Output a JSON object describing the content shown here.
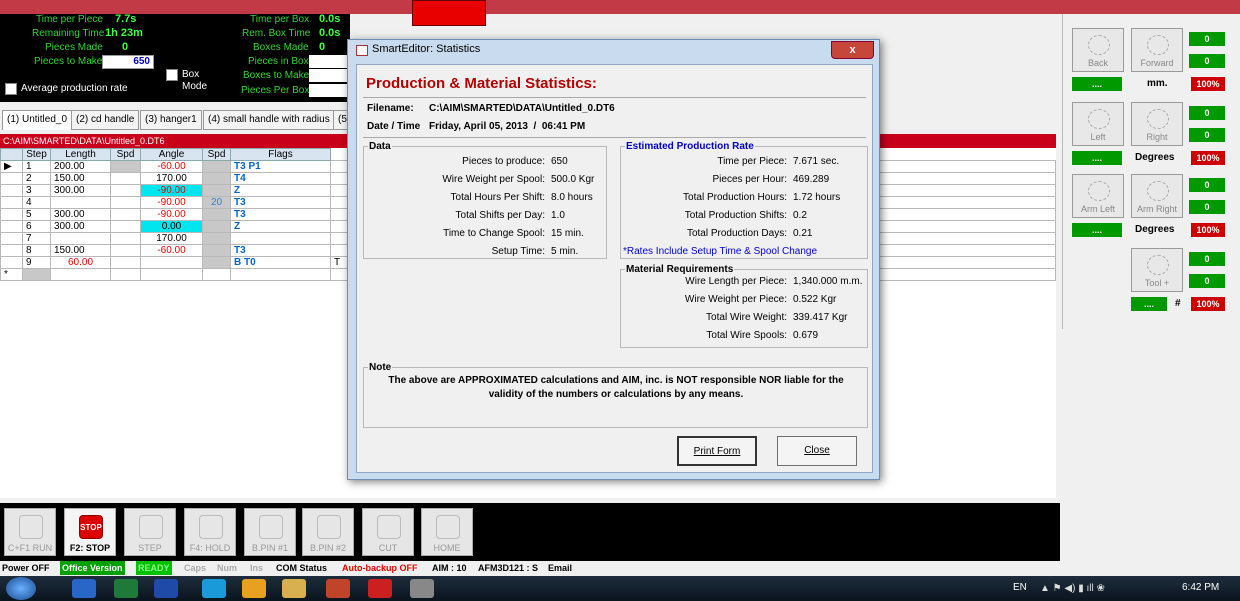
{
  "stats": {
    "time_per_piece_label": "Time per Piece",
    "time_per_piece": "7.7s",
    "remaining_time_label": "Remaining Time",
    "remaining_time": "1h 23m",
    "pieces_made_label": "Pieces Made",
    "pieces_made": "0",
    "pieces_to_make_label": "Pieces to Make",
    "pieces_to_make": "650",
    "time_per_box_label": "Time per Box",
    "time_per_box": "0.0s",
    "rem_box_time_label": "Rem. Box Time",
    "rem_box_time": "0.0s",
    "boxes_made_label": "Boxes Made",
    "boxes_made": "0",
    "pieces_in_box_label": "Pieces in Box",
    "boxes_to_make_label": "Boxes to Make",
    "pieces_per_box_label": "Pieces Per Box",
    "box_mode_label_1": "Box",
    "box_mode_label_2": "Mode",
    "avg_rate_label": "Average production rate"
  },
  "tabs": [
    "(1) Untitled_0",
    "(2) cd handle",
    "(3) hanger1",
    "(4) small handle with radius",
    "(5"
  ],
  "path": "C:\\AIM\\SMARTED\\DATA\\Untitled_0.DT6",
  "grid": {
    "headers": [
      "Step",
      "Length",
      "Spd",
      "Angle",
      "Spd",
      "Flags"
    ],
    "rows": [
      {
        "step": "1",
        "length": "200.00",
        "angle": "-60.00",
        "spd2": "",
        "flags": "T3 P1"
      },
      {
        "step": "2",
        "length": "150.00",
        "angle": "170.00",
        "spd2": "",
        "flags": "T4"
      },
      {
        "step": "3",
        "length": "300.00",
        "angle": "-90.00",
        "spd2": "",
        "flags": "Z"
      },
      {
        "step": "4",
        "length": "",
        "angle": "-90.00",
        "spd2": "20",
        "flags": "T3"
      },
      {
        "step": "5",
        "length": "300.00",
        "angle": "-90.00",
        "spd2": "",
        "flags": "T3"
      },
      {
        "step": "6",
        "length": "300.00",
        "angle": "0.00",
        "spd2": "",
        "flags": "Z"
      },
      {
        "step": "7",
        "length": "",
        "angle": "170.00",
        "spd2": "",
        "flags": ""
      },
      {
        "step": "8",
        "length": "150.00",
        "angle": "-60.00",
        "spd2": "",
        "flags": "T3"
      },
      {
        "step": "9",
        "length": "60.00",
        "angle": "",
        "spd2": "",
        "flags": "B T0"
      }
    ],
    "new_row_marker": "*",
    "row9_extra": "T"
  },
  "right_panel": {
    "back": "Back",
    "forward": "Forward",
    "mm": "mm.",
    "left": "Left",
    "right": "Right",
    "degrees1": "Degrees",
    "arm_left": "Arm Left",
    "arm_right": "Arm Right",
    "degrees2": "Degrees",
    "tool": "Tool +",
    "hash": "#",
    "zero": "0",
    "pct": "100%",
    "dots": "...."
  },
  "toolbar": [
    {
      "label": "C+F1 RUN"
    },
    {
      "label": "F2: STOP"
    },
    {
      "label": "STEP"
    },
    {
      "label": "F4: HOLD"
    },
    {
      "label": "B.PIN #1"
    },
    {
      "label": "B.PIN #2"
    },
    {
      "label": "CUT"
    },
    {
      "label": "HOME"
    }
  ],
  "stop_text": "STOP",
  "statusbar": {
    "power": "Power OFF",
    "office": "Office Version",
    "ready": "READY",
    "caps": "Caps",
    "num": "Num",
    "ins": "Ins",
    "com": "COM Status",
    "autobackup": "Auto-backup OFF",
    "aim": "AIM : 10",
    "afm": "AFM3D121 : S",
    "email": "Email"
  },
  "taskbar": {
    "lang": "EN",
    "time": "6:42 PM"
  },
  "dialog": {
    "title": "SmartEditor: Statistics",
    "heading": "Production & Material Statistics:",
    "filename_label": "Filename:",
    "filename": "C:\\AIM\\SMARTED\\DATA\\Untitled_0.DT6",
    "datetime_label": "Date / Time",
    "datetime": "Friday, April 05, 2013  /  06:41 PM",
    "data_legend": "Data",
    "data_rows": [
      {
        "label": "Pieces to produce:",
        "value": "650"
      },
      {
        "label": "Wire Weight per Spool:",
        "value": "500.0 Kgr"
      },
      {
        "label": "Total Hours Per Shift:",
        "value": "8.0 hours"
      },
      {
        "label": "Total Shifts per Day:",
        "value": "1.0"
      },
      {
        "label": "Time to Change Spool:",
        "value": "15 min."
      },
      {
        "label": "Setup Time:",
        "value": "5 min."
      }
    ],
    "rate_legend": "Estimated Production Rate",
    "rate_rows": [
      {
        "label": "Time per Piece:",
        "value": "7.671 sec."
      },
      {
        "label": "Pieces per Hour:",
        "value": "469.289"
      },
      {
        "label": "Total Production Hours:",
        "value": "1.72 hours"
      },
      {
        "label": "Total Production Shifts:",
        "value": "0.2"
      },
      {
        "label": "Total Production Days:",
        "value": "0.21"
      }
    ],
    "rate_note": "*Rates Include Setup Time & Spool Change",
    "material_legend": "Material Requirements",
    "material_rows": [
      {
        "label": "Wire Length per Piece:",
        "value": "1,340.000 m.m."
      },
      {
        "label": "Wire Weight per Piece:",
        "value": "0.522 Kgr"
      },
      {
        "label": "Total Wire Weight:",
        "value": "339.417 Kgr"
      },
      {
        "label": "Total Wire Spools:",
        "value": "0.679"
      }
    ],
    "note_legend": "Note",
    "note_line1": "The above are APPROXIMATED calculations and AIM, inc. is NOT responsible NOR liable for the",
    "note_line2": "validity of the numbers or calculations by any means.",
    "print_button": "Print Form",
    "close_button": "Close",
    "x": "x"
  }
}
